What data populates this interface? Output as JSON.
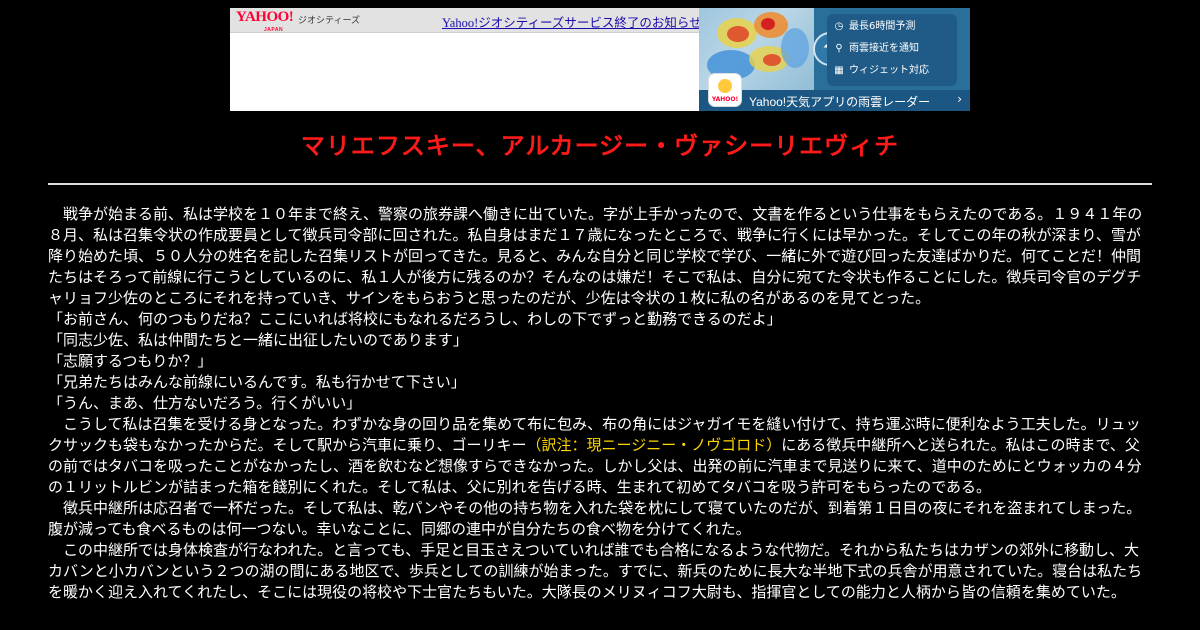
{
  "banner": {
    "logo_text": "YAHOO!",
    "logo_sub": "JAPAN",
    "brand": "ジオシティーズ",
    "notice_link": "Yahoo!ジオシティーズサービス終了のお知らせ",
    "ad": {
      "features": [
        {
          "icon": "clock-icon",
          "glyph": "◷",
          "label": "最長6時間予測"
        },
        {
          "icon": "location-pin-icon",
          "glyph": "⚲",
          "label": "雨雲接近を通知"
        },
        {
          "icon": "widget-grid-icon",
          "glyph": "▦",
          "label": "ウィジェット対応"
        }
      ],
      "umbrella_glyph": "☂",
      "footer": "Yahoo!天気アプリの雨雲レーダー",
      "arrow": "›",
      "app_icon_label": "YAHOO!"
    }
  },
  "page": {
    "title": "マリエフスキー、アルカージー・ヴァシーリエヴィチ",
    "title_color": "#ff1a1a",
    "note_color": "#ffd700"
  },
  "body": {
    "p1": "　戦争が始まる前、私は学校を１０年まで終え、警察の旅券課へ働きに出ていた。字が上手かったので、文書を作るという仕事をもらえたのである。１９４１年の８月、私は召集令状の作成要員として徴兵司令部に回された。私自身はまだ１７歳になったところで、戦争に行くには早かった。そしてこの年の秋が深まり、雪が降り始めた頃、５０人分の姓名を記した召集リストが回ってきた。見ると、みんな自分と同じ学校で学び、一緒に外で遊び回った友達ばかりだ。何てことだ！仲間たちはそろって前線に行こうとしているのに、私１人が後方に残るのか？そんなのは嫌だ！そこで私は、自分に宛てた令状も作ることにした。徴兵司令官のデグチャリョフ少佐のところにそれを持っていき、サインをもらおうと思ったのだが、少佐は令状の１枚に私の名があるのを見てとった。",
    "q1": "「お前さん、何のつもりだね？ここにいれば将校にもなれるだろうし、わしの下でずっと勤務できるのだよ」",
    "q2": "「同志少佐、私は仲間たちと一緒に出征したいのであります」",
    "q3": "「志願するつもりか？」",
    "q4": "「兄弟たちはみんな前線にいるんです。私も行かせて下さい」",
    "q5": "「うん、まあ、仕方ないだろう。行くがいい」",
    "p2a": "　こうして私は召集を受ける身となった。わずかな身の回り品を集めて布に包み、布の角にはジャガイモを縫い付けて、持ち運ぶ時に便利なよう工夫した。リュックサックも袋もなかったからだ。そして駅から汽車に乗り、ゴーリキー",
    "p2_note": "（訳注：現ニージニー・ノヴゴロド）",
    "p2b": "にある徴兵中継所へと送られた。私はこの時まで、父の前ではタバコを吸ったことがなかったし、酒を飲むなど想像すらできなかった。しかし父は、出発の前に汽車まで見送りに来て、道中のためにとウォッカの４分の１リットルビンが詰まった箱を餞別にくれた。そして私は、父に別れを告げる時、生まれて初めてタバコを吸う許可をもらったのである。",
    "p3": "　徴兵中継所は応召者で一杯だった。そして私は、乾パンやその他の持ち物を入れた袋を枕にして寝ていたのだが、到着第１日目の夜にそれを盗まれてしまった。腹が減っても食べるものは何一つない。幸いなことに、同郷の連中が自分たちの食べ物を分けてくれた。",
    "p4": "　この中継所では身体検査が行なわれた。と言っても、手足と目玉さえついていれば誰でも合格になるような代物だ。それから私たちはカザンの郊外に移動し、大カバンと小カバンという２つの湖の間にある地区で、歩兵としての訓練が始まった。すでに、新兵のために長大な半地下式の兵舎が用意されていた。寝台は私たちを暖かく迎え入れてくれたし、そこには現役の将校や下士官たちもいた。大隊長のメリヌィコフ大尉も、指揮官としての能力と人柄から皆の信頼を集めていた。"
  }
}
